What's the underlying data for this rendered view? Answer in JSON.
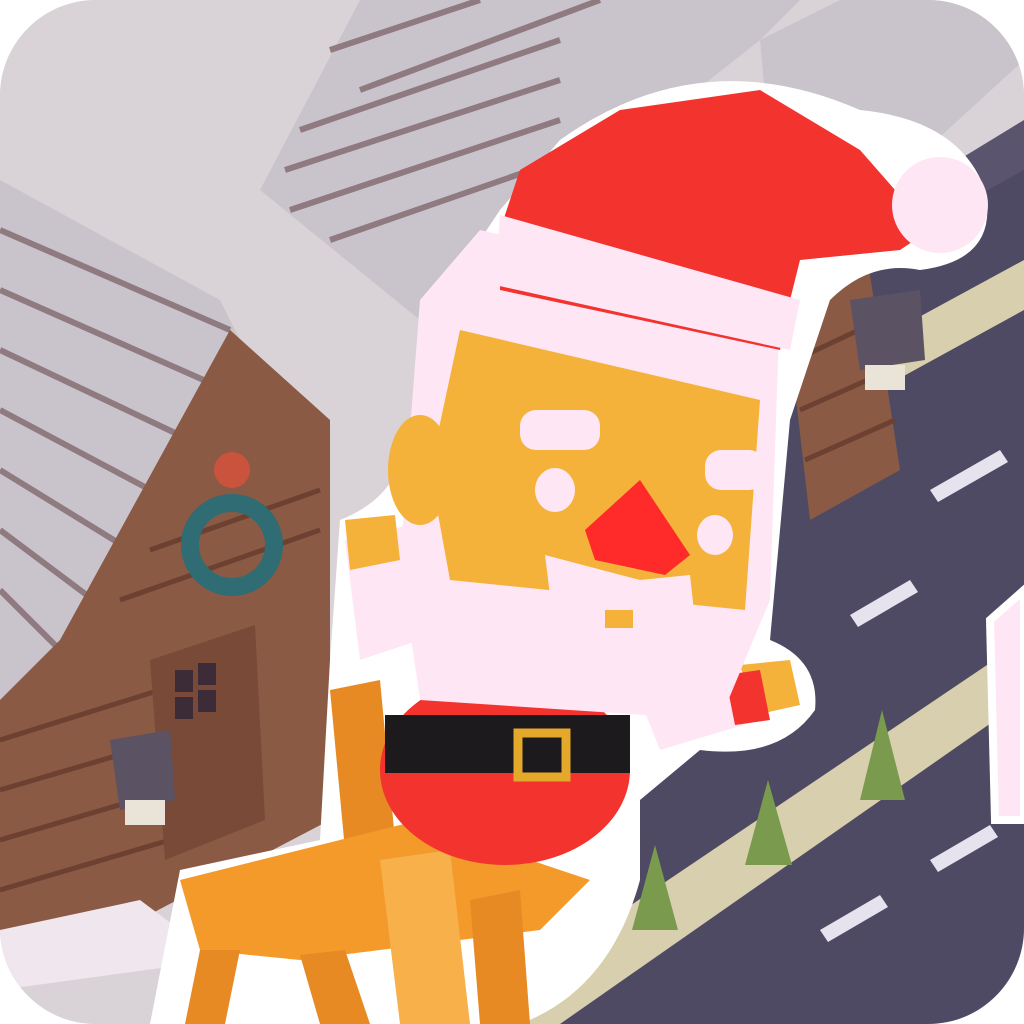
{
  "app_icon": {
    "subject": "santa-on-wooden-stool-icon",
    "palette": {
      "sky": "#d9d2d6",
      "roof": "#c9c4cc",
      "roof_stripe": "#8f7a7f",
      "wood": "#8a5a44",
      "wood_dark": "#6c4132",
      "road": "#4f4a63",
      "road_line": "#e6e3ee",
      "sidewalk": "#d8cfae",
      "tree": "#7a9a4e",
      "hat_red": "#f2332e",
      "hat_white": "#ffe6f4",
      "skin": "#f4b23a",
      "nose": "#ff2a2a",
      "belt": "#1c1a1c",
      "buckle": "#e4a82a",
      "stool": "#f39a2b",
      "outline": "#ffffff",
      "wreath": "#2f6c73",
      "wreath_bow": "#c9533d"
    }
  }
}
